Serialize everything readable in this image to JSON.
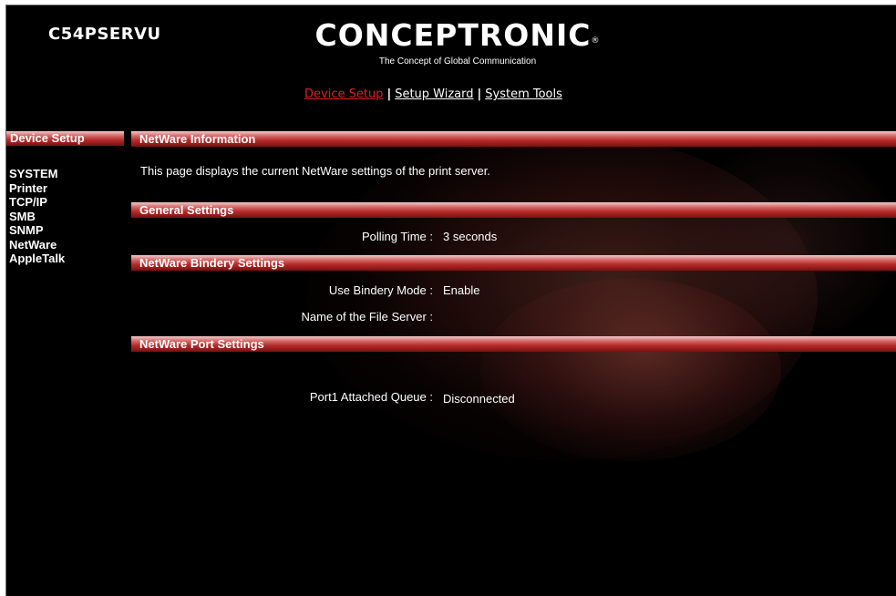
{
  "header": {
    "model": "C54PSERVU",
    "logo_text": "CONCEPTRONIC",
    "logo_reg": "®",
    "tagline": "The Concept of Global Communication"
  },
  "topnav": {
    "items": [
      {
        "label": "Device Setup",
        "active": true
      },
      {
        "label": "Setup Wizard",
        "active": false
      },
      {
        "label": "System Tools",
        "active": false
      }
    ],
    "separator": "|"
  },
  "sidebar": {
    "title": "Device Setup",
    "items": [
      {
        "label": "SYSTEM"
      },
      {
        "label": "Printer"
      },
      {
        "label": "TCP/IP"
      },
      {
        "label": "SMB"
      },
      {
        "label": "SNMP"
      },
      {
        "label": "NetWare"
      },
      {
        "label": "AppleTalk"
      }
    ]
  },
  "main": {
    "info_title": "NetWare Information",
    "description": "This page displays the current NetWare settings of the print server.",
    "general": {
      "title": "General Settings",
      "polling_label": "Polling Time :",
      "polling_value": "3 seconds"
    },
    "bindery": {
      "title": "NetWare Bindery Settings",
      "mode_label": "Use Bindery Mode :",
      "mode_value": "Enable",
      "server_label": "Name of the File Server :",
      "server_value": ""
    },
    "port": {
      "title": "NetWare Port Settings",
      "queue_label": "Port1 Attached Queue :",
      "queue_value": "Disconnected"
    }
  },
  "colors": {
    "background": "#000000",
    "active_link": "#e02020",
    "section_bar": "#b52a2a",
    "text": "#ffffff"
  }
}
